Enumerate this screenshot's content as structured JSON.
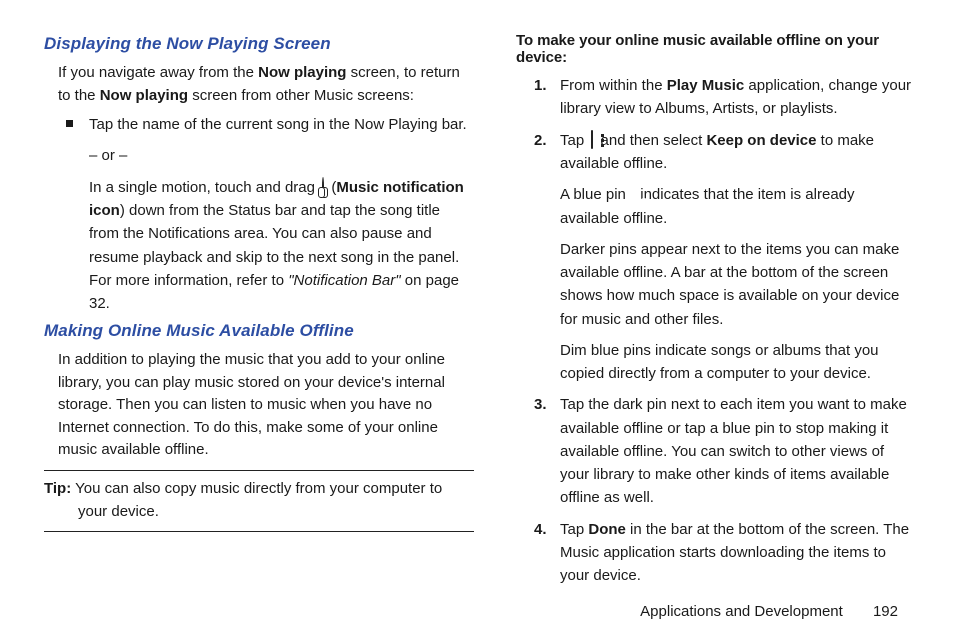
{
  "left": {
    "heading1": "Displaying the Now Playing Screen",
    "para1_a": "If you navigate away from the ",
    "para1_b": "Now playing",
    "para1_c": " screen, to return to the ",
    "para1_d": "Now playing",
    "para1_e": " screen from other Music screens:",
    "bullet1": "Tap the name of the current song in the Now Playing bar.",
    "or": "– or –",
    "bullet2_a": "In a single motion, touch and drag ",
    "bullet2_b": " (",
    "bullet2_c": "Music notification icon",
    "bullet2_d": ") down from the Status bar and tap the song title from the Notifications area. You can also pause and resume playback and skip to the next song in the panel. For more information, refer to ",
    "bullet2_ref": "\"Notification Bar\"",
    "bullet2_e": "  on page 32.",
    "heading2": "Making Online Music Available Offline",
    "para2": "In addition to playing the music that you add to your online library, you can play music stored on your device's internal storage. Then you can listen to music when you have no Internet connection. To do this, make some of your online music available offline.",
    "tip_label": "Tip:",
    "tip_text_a": " You can also copy music directly from your computer to ",
    "tip_text_b": "your device."
  },
  "right": {
    "bold_line": "To make your online music available offline on your device:",
    "items": [
      {
        "num": "1.",
        "a": "From within the ",
        "b": "Play Music",
        "c": " application, change your library view to Albums, Artists, or playlists."
      },
      {
        "num": "2.",
        "a": "Tap ",
        "b": " and then select ",
        "c": "Keep on device",
        "d": " to make available offline.",
        "sub1_a": "A blue pin ",
        "sub1_b": " indicates that the item is already available offline.",
        "sub2": "Darker pins appear next to the items you can make available offline. A bar at the bottom of the screen shows how much space is available on your device for music and other files.",
        "sub3": "Dim blue pins indicate songs or albums that you copied directly from a computer to your device."
      },
      {
        "num": "3.",
        "a": "Tap the dark pin next to each item you want to make available offline or tap a blue pin to stop making it available offline. You can switch to other views of your library to make other kinds of items available offline as well."
      },
      {
        "num": "4.",
        "a": "Tap ",
        "b": "Done",
        "c": " in the bar at the bottom of the screen. The Music application starts downloading the items to your device."
      }
    ]
  },
  "footer": {
    "section": "Applications and Development",
    "page": "192"
  }
}
